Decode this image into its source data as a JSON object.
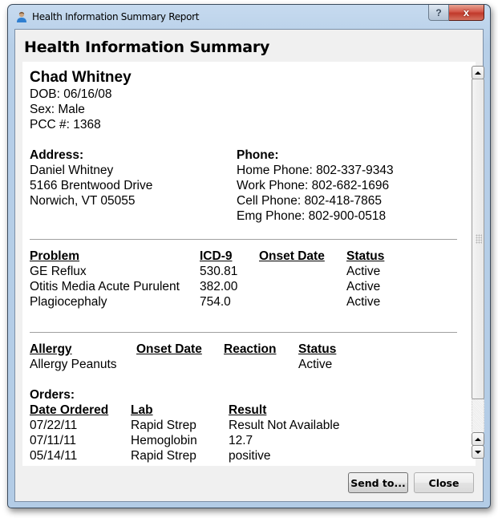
{
  "window": {
    "title": "Health Information Summary Report",
    "help_label": "?",
    "close_label": "x"
  },
  "heading": "Health Information Summary",
  "patient": {
    "name": "Chad Whitney",
    "dob": "DOB: 06/16/08",
    "sex": "Sex: Male",
    "pcc": "PCC #: 1368"
  },
  "address": {
    "label": "Address:",
    "lines": [
      "Daniel Whitney",
      "5166 Brentwood Drive",
      "Norwich, VT 05055"
    ]
  },
  "phone": {
    "label": "Phone:",
    "lines": [
      "Home Phone: 802-337-9343",
      "Work Phone: 802-682-1696",
      "Cell Phone: 802-418-7865",
      "Emg Phone: 802-900-0518"
    ]
  },
  "problems": {
    "headers": [
      "Problem",
      "ICD-9",
      "Onset Date",
      "Status"
    ],
    "rows": [
      [
        "GE Reflux",
        "530.81",
        "",
        "Active"
      ],
      [
        "Otitis Media Acute Purulent",
        "382.00",
        "",
        "Active"
      ],
      [
        "Plagiocephaly",
        "754.0",
        "",
        "Active"
      ]
    ]
  },
  "allergies": {
    "headers": [
      "Allergy",
      "Onset Date",
      "Reaction",
      "Status"
    ],
    "rows": [
      [
        "Allergy Peanuts",
        "",
        "",
        "Active"
      ]
    ]
  },
  "orders": {
    "title": "Orders:",
    "headers": [
      "Date Ordered",
      "Lab",
      "Result"
    ],
    "rows": [
      [
        "07/22/11",
        "Rapid Strep",
        "Result Not Available"
      ],
      [
        "07/11/11",
        "Hemoglobin",
        "12.7"
      ],
      [
        "05/14/11",
        "Rapid Strep",
        "positive"
      ]
    ]
  },
  "buttons": {
    "send": "Send to...",
    "close": "Close"
  }
}
